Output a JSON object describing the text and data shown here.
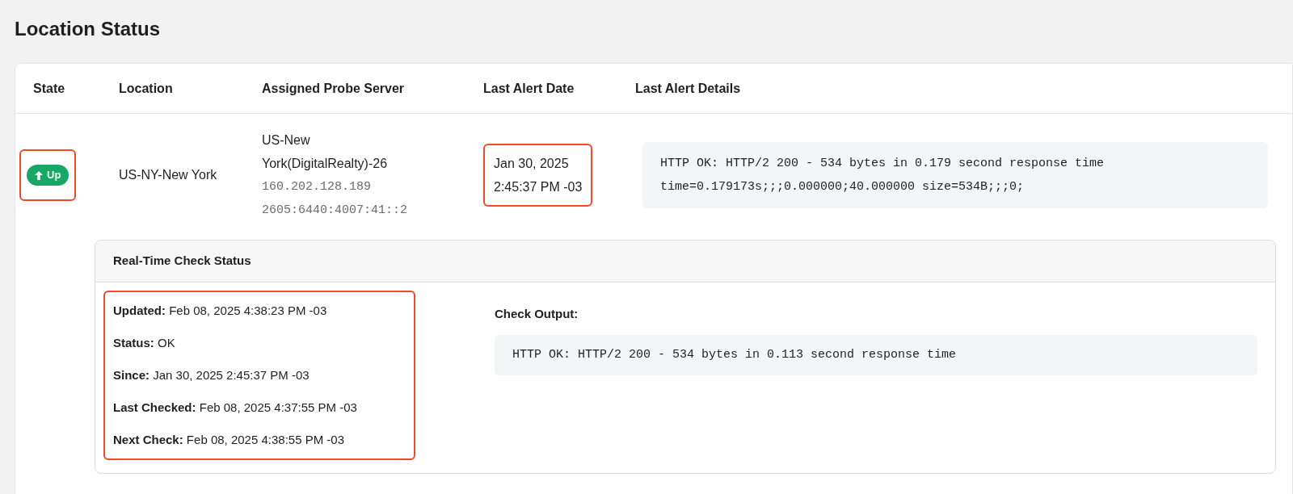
{
  "page": {
    "title": "Location Status"
  },
  "table": {
    "columns": [
      "State",
      "Location",
      "Assigned Probe Server",
      "Last Alert Date",
      "Last Alert Details"
    ],
    "rows": [
      {
        "state": {
          "label": "Up",
          "kind": "up",
          "highlighted": true
        },
        "location": "US-NY-New York",
        "probe_server": {
          "name": "US-New York(DigitalRealty)-26",
          "addresses": [
            "160.202.128.189",
            "2605:6440:4007:41::2"
          ]
        },
        "last_alert_date": {
          "lines": [
            "Jan 30, 2025",
            "2:45:37 PM -03"
          ],
          "highlighted": true
        },
        "last_alert_details": [
          "HTTP OK: HTTP/2 200 - 534 bytes in 0.179 second response time",
          "time=0.179173s;;;0.000000;40.000000 size=534B;;;0;"
        ]
      }
    ]
  },
  "realtime": {
    "title": "Real-Time Check Status",
    "highlighted": true,
    "fields": [
      "**Updated:** Feb 08, 2025 4:38:23 PM -03",
      "**Status:** OK",
      "**Since:** Jan 30, 2025 2:45:37 PM -03",
      "**Last Checked:** Feb 08, 2025 4:37:55 PM -03",
      "**Next Check:** Feb 08, 2025 4:38:55 PM -03"
    ],
    "output_label": "Check Output:",
    "output": "HTTP OK: HTTP/2 200 - 534 bytes in 0.113 second response time"
  }
}
